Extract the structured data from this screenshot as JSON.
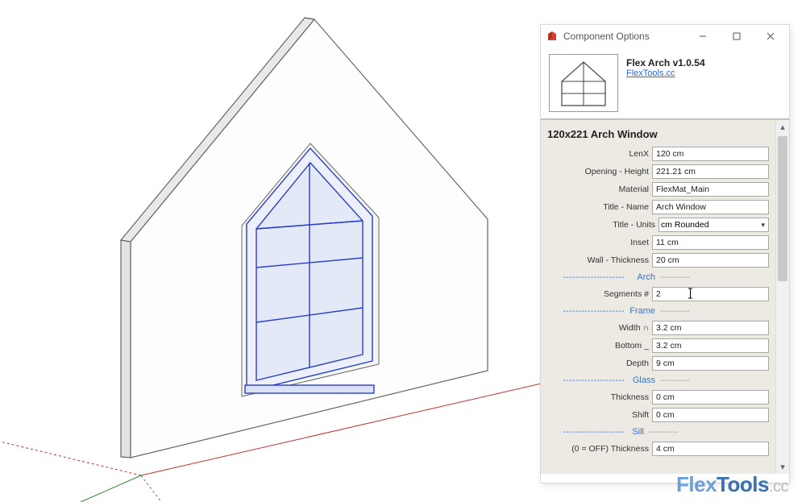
{
  "window": {
    "title": "Component Options"
  },
  "header": {
    "component_name": "Flex Arch v1.0.54",
    "link_text": "FlexTools.cc"
  },
  "instance_title": "120x221 Arch Window",
  "sections": {
    "arch": "Arch",
    "frame": "Frame",
    "glass": "Glass",
    "sill": "Sill"
  },
  "props": {
    "lenx": {
      "label": "LenX",
      "value": "120 cm"
    },
    "opening_height": {
      "label": "Opening - Height",
      "value": "221.21 cm"
    },
    "material": {
      "label": "Material",
      "value": "FlexMat_Main"
    },
    "title_name": {
      "label": "Title - Name",
      "value": "Arch Window"
    },
    "title_units": {
      "label": "Title - Units",
      "value": "cm Rounded"
    },
    "inset": {
      "label": "Inset",
      "value": "11 cm"
    },
    "wall_thickness": {
      "label": "Wall - Thickness",
      "value": "20 cm"
    },
    "segments": {
      "label": "Segments #",
      "value": "2"
    },
    "frame_width": {
      "label": "Width ∩",
      "value": "3.2 cm"
    },
    "frame_bottom": {
      "label": "Bottom _",
      "value": "3.2 cm"
    },
    "frame_depth": {
      "label": "Depth",
      "value": "9 cm"
    },
    "glass_thickness": {
      "label": "Thickness",
      "value": "0 cm"
    },
    "glass_shift": {
      "label": "Shift",
      "value": "0 cm"
    },
    "sill_thickness": {
      "label": "(0 = OFF) Thickness",
      "value": "4 cm"
    }
  },
  "watermark": {
    "part1": "Flex",
    "part2": "Tools",
    "suffix": ".cc"
  }
}
